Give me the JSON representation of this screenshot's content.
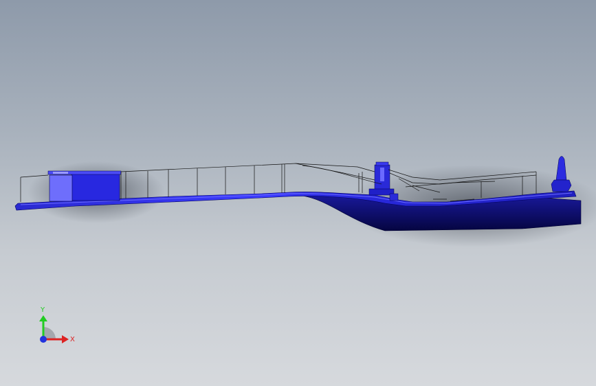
{
  "viewport": {
    "model_name": "cad-part-side-view",
    "colors": {
      "background_top": "#8e9aaa",
      "background_bottom": "#d6d9dd",
      "part_face": "#2b2bd6",
      "part_bright": "#3a3aff",
      "part_dark": "#06064a",
      "wireframe": "#111111"
    }
  },
  "triad": {
    "y_label": "Y",
    "x_label": "X",
    "y_color": "#22cc22",
    "x_color": "#dd2222",
    "z_color": "#2233dd"
  }
}
